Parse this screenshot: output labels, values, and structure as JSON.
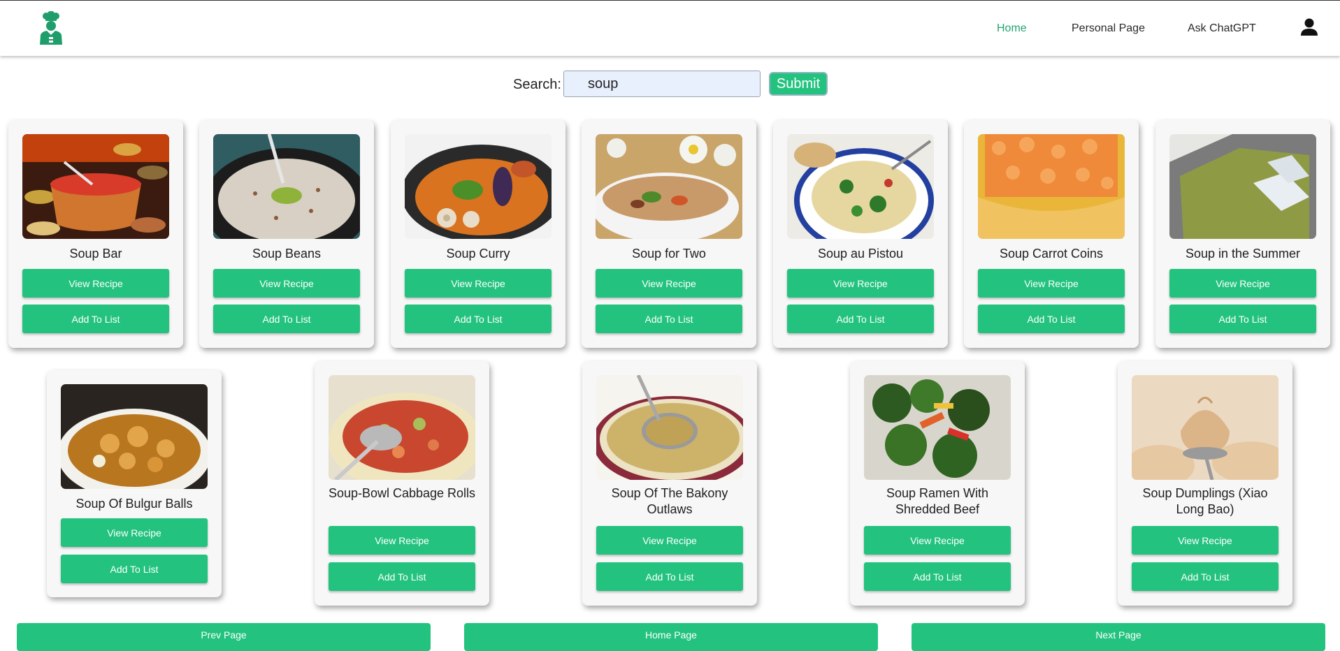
{
  "nav": {
    "links": [
      {
        "label": "Home",
        "active": true
      },
      {
        "label": "Personal Page",
        "active": false
      },
      {
        "label": "Ask ChatGPT",
        "active": false
      }
    ],
    "logo_icon": "chef-icon",
    "user_icon": "user-icon"
  },
  "search": {
    "label": "Search:",
    "value": "soup",
    "submit_label": "Submit"
  },
  "recipes": [
    {
      "title": "Soup Bar",
      "view_label": "View Recipe",
      "add_label": "Add To List"
    },
    {
      "title": "Soup Beans",
      "view_label": "View Recipe",
      "add_label": "Add To List"
    },
    {
      "title": "Soup Curry",
      "view_label": "View Recipe",
      "add_label": "Add To List"
    },
    {
      "title": "Soup for Two",
      "view_label": "View Recipe",
      "add_label": "Add To List"
    },
    {
      "title": "Soup au Pistou",
      "view_label": "View Recipe",
      "add_label": "Add To List"
    },
    {
      "title": "Soup Carrot Coins",
      "view_label": "View Recipe",
      "add_label": "Add To List"
    },
    {
      "title": "Soup in the Summer",
      "view_label": "View Recipe",
      "add_label": "Add To List"
    },
    {
      "title": "Soup Of Bulgur Balls",
      "view_label": "View Recipe",
      "add_label": "Add To List"
    },
    {
      "title": "Soup-Bowl Cabbage Rolls",
      "view_label": "View Recipe",
      "add_label": "Add To List"
    },
    {
      "title": "Soup Of The Bakony Outlaws",
      "view_label": "View Recipe",
      "add_label": "Add To List"
    },
    {
      "title": "Soup Ramen With Shredded Beef",
      "view_label": "View Recipe",
      "add_label": "Add To List"
    },
    {
      "title": "Soup Dumplings (Xiao Long Bao)",
      "view_label": "View Recipe",
      "add_label": "Add To List"
    }
  ],
  "pagination": {
    "prev_label": "Prev Page",
    "home_label": "Home Page",
    "next_label": "Next Page"
  },
  "colors": {
    "accent": "#23c37f",
    "active_link": "#23a36f",
    "logo": "#1f9e6b"
  }
}
